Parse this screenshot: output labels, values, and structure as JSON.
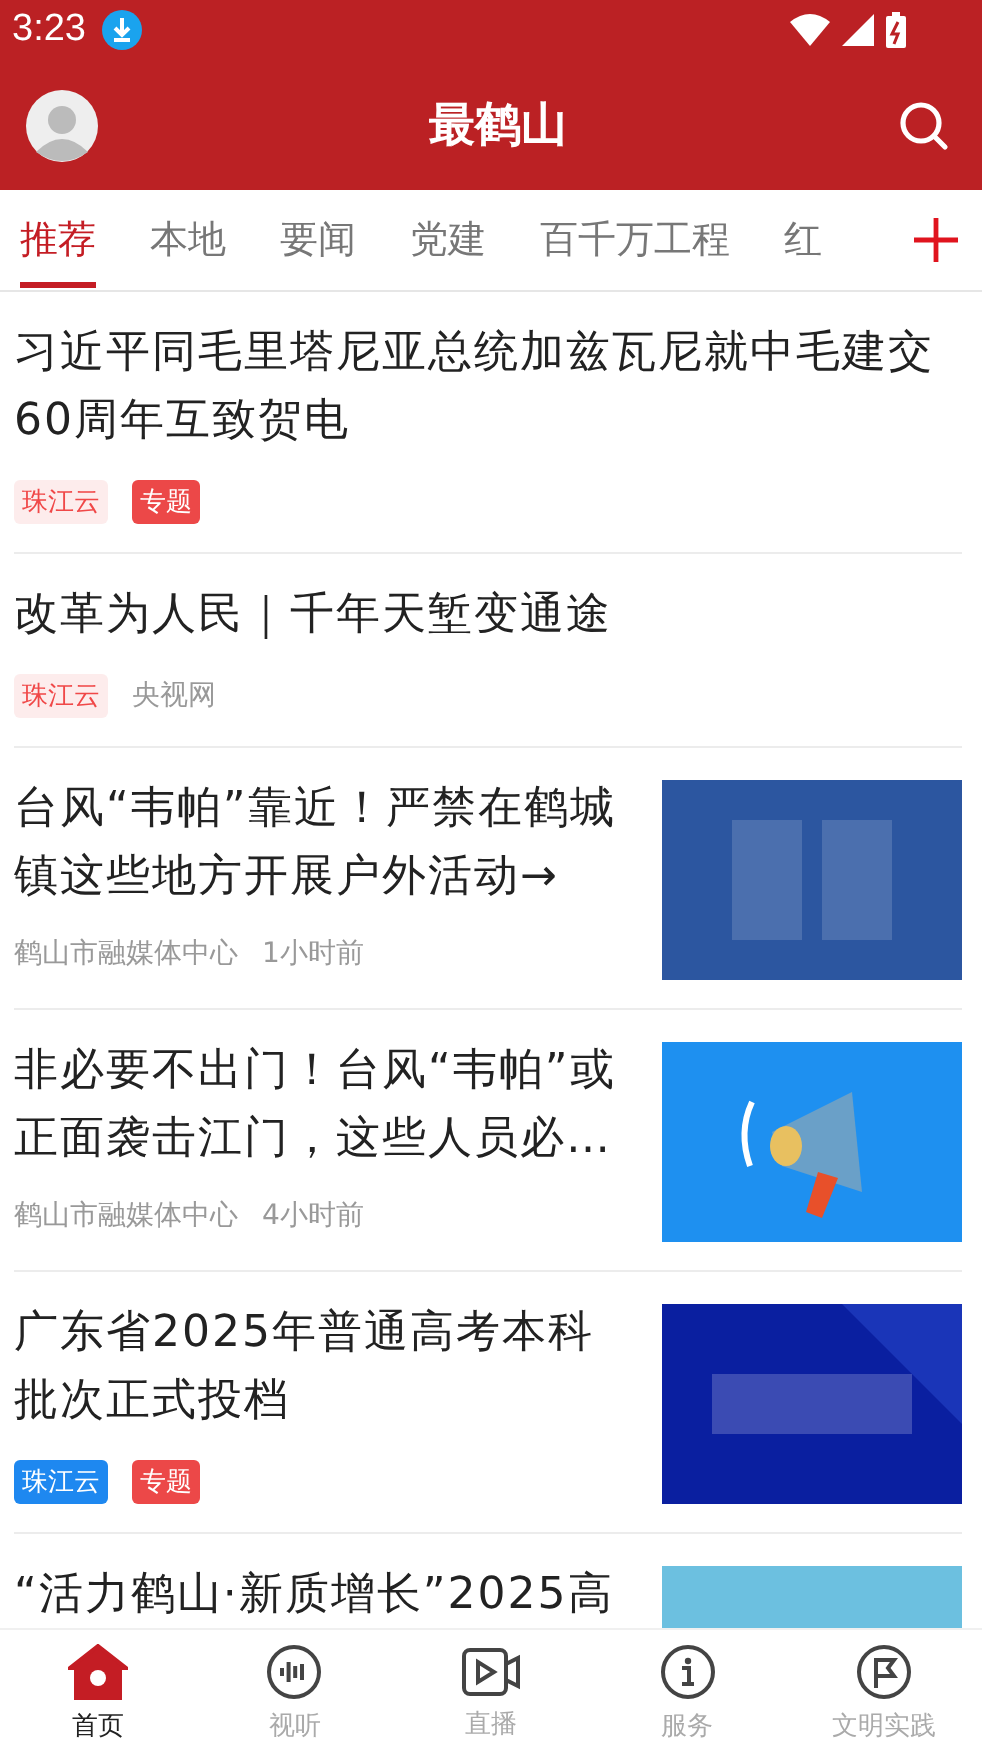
{
  "status_bar": {
    "time": "3:23"
  },
  "header": {
    "title": "最鹤山"
  },
  "tabs": [
    {
      "label": "推荐",
      "selected": true
    },
    {
      "label": "本地",
      "selected": false
    },
    {
      "label": "要闻",
      "selected": false
    },
    {
      "label": "党建",
      "selected": false
    },
    {
      "label": "百千万工程",
      "selected": false
    },
    {
      "label": "红",
      "selected": false
    }
  ],
  "articles": [
    {
      "kind": "plain",
      "title": "习近平同毛里塔尼亚总统加兹瓦尼就中毛建交60周年互致贺电",
      "tags": [
        {
          "text": "珠江云",
          "kind": "pale"
        },
        {
          "text": "专题",
          "kind": "red"
        }
      ]
    },
    {
      "kind": "plain",
      "title": "改革为人民｜千年天堑变通途",
      "tags": [
        {
          "text": "珠江云",
          "kind": "pale"
        }
      ],
      "source": "央视网"
    },
    {
      "kind": "thumbnail",
      "title": "台风“韦帕”靠近！严禁在鹤城镇这些地方开展户外活动→",
      "source": "鹤山市融媒体中心",
      "time": "1小时前"
    },
    {
      "kind": "thumbnail",
      "title": "非必要不出门！台风“韦帕”或正面袭击江门，这些人员必…",
      "source": "鹤山市融媒体中心",
      "time": "4小时前"
    },
    {
      "kind": "thumbnail",
      "title": "广东省2025年普通高考本科批次正式投档",
      "tags": [
        {
          "text": "珠江云",
          "kind": "blue"
        },
        {
          "text": "专题",
          "kind": "red"
        }
      ]
    },
    {
      "kind": "thumbnail",
      "title": "“活力鹤山·新质增长”2025高"
    }
  ],
  "bottom_nav": [
    {
      "label": "首页",
      "selected": true
    },
    {
      "label": "视听",
      "selected": false
    },
    {
      "label": "直播",
      "selected": false
    },
    {
      "label": "服务",
      "selected": false
    },
    {
      "label": "文明实践",
      "selected": false
    }
  ]
}
